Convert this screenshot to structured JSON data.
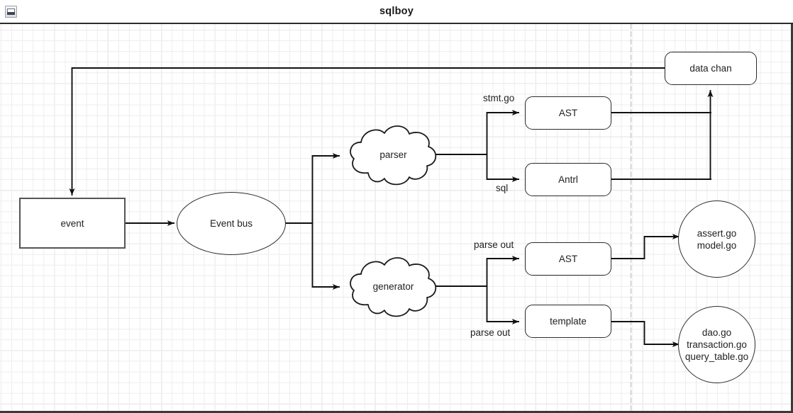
{
  "window": {
    "title": "sqlboy",
    "collapse_icon": "collapse-icon"
  },
  "diagram": {
    "nodes": [
      {
        "id": "event",
        "label": "event",
        "shape": "rect"
      },
      {
        "id": "event-bus",
        "label": "Event bus",
        "shape": "ellipse"
      },
      {
        "id": "parser",
        "label": "parser",
        "shape": "cloud"
      },
      {
        "id": "generator",
        "label": "generator",
        "shape": "cloud"
      },
      {
        "id": "ast-parser",
        "label": "AST",
        "shape": "rounded-rect"
      },
      {
        "id": "antrl",
        "label": "Antrl",
        "shape": "rounded-rect"
      },
      {
        "id": "data-chan",
        "label": "data chan",
        "shape": "rounded-rect"
      },
      {
        "id": "ast-gen",
        "label": "AST",
        "shape": "rounded-rect"
      },
      {
        "id": "template",
        "label": "template",
        "shape": "rounded-rect"
      },
      {
        "id": "assert-model",
        "label": "assert.go\nmodel.go",
        "shape": "circle",
        "lines": [
          "assert.go",
          "model.go"
        ]
      },
      {
        "id": "dao-files",
        "label": "dao.go\ntransaction.go\nquery_table.go",
        "shape": "circle",
        "lines": [
          "dao.go",
          "transaction.go",
          "query_table.go"
        ]
      }
    ],
    "edge_labels": [
      {
        "id": "stmt-go",
        "text": "stmt.go"
      },
      {
        "id": "sql",
        "text": "sql"
      },
      {
        "id": "parse-out-top",
        "text": "parse out"
      },
      {
        "id": "parse-out-bottom",
        "text": "parse out"
      }
    ]
  },
  "colors": {
    "stroke": "#2b2b2b",
    "rect_stroke": "#555555",
    "grid_minor": "#ededed",
    "grid_major": "#cfcfcf",
    "canvas_border": "#3a3a3a",
    "text": "#1f1f1f",
    "dashed_guide": "#c8c8c8"
  }
}
